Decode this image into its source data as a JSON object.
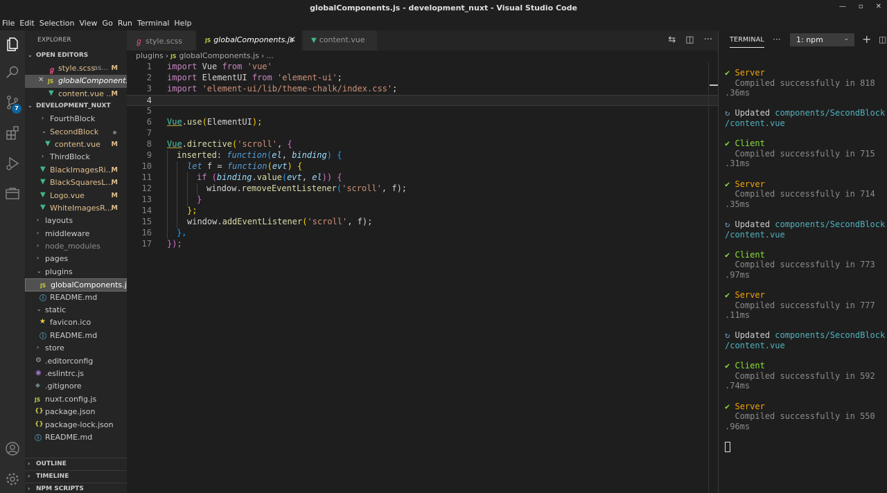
{
  "window": {
    "title": "globalComponents.js - development_nuxt - Visual Studio Code"
  },
  "menu": [
    "File",
    "Edit",
    "Selection",
    "View",
    "Go",
    "Run",
    "Terminal",
    "Help"
  ],
  "activity": {
    "scm_badge": "7"
  },
  "sidebar": {
    "title": "EXPLORER",
    "open_editors_header": "OPEN EDITORS",
    "open_editors": [
      {
        "name": "style.scss",
        "extra": "as...",
        "mark": "M"
      },
      {
        "name": "globalComponent...",
        "mark": ""
      },
      {
        "name": "content.vue ...",
        "mark": "M"
      }
    ],
    "project_header": "DEVELOPMENT_NUXT",
    "tree": [
      {
        "name": "FourthBlock",
        "mark": ""
      },
      {
        "name": "SecondBlock",
        "mark": ""
      },
      {
        "name": "content.vue",
        "mark": "M"
      },
      {
        "name": "ThirdBlock",
        "mark": ""
      },
      {
        "name": "BlackImagesRi...",
        "mark": "M"
      },
      {
        "name": "BlackSquaresL...",
        "mark": "M"
      },
      {
        "name": "Logo.vue",
        "mark": "M"
      },
      {
        "name": "WhiteImagesR...",
        "mark": "M"
      },
      {
        "name": "layouts",
        "mark": ""
      },
      {
        "name": "middleware",
        "mark": ""
      },
      {
        "name": "node_modules",
        "mark": ""
      },
      {
        "name": "pages",
        "mark": ""
      },
      {
        "name": "plugins",
        "mark": ""
      },
      {
        "name": "globalComponents.js",
        "mark": ""
      },
      {
        "name": "README.md",
        "mark": ""
      },
      {
        "name": "static",
        "mark": ""
      },
      {
        "name": "favicon.ico",
        "mark": ""
      },
      {
        "name": "README.md",
        "mark": ""
      },
      {
        "name": "store",
        "mark": ""
      },
      {
        "name": ".editorconfig",
        "mark": ""
      },
      {
        "name": ".eslintrc.js",
        "mark": ""
      },
      {
        "name": ".gitignore",
        "mark": ""
      },
      {
        "name": "nuxt.config.js",
        "mark": ""
      },
      {
        "name": "package.json",
        "mark": ""
      },
      {
        "name": "package-lock.json",
        "mark": ""
      },
      {
        "name": "README.md",
        "mark": ""
      }
    ],
    "bottom_sections": [
      "OUTLINE",
      "TIMELINE",
      "NPM SCRIPTS"
    ]
  },
  "tabs": [
    {
      "label": "style.scss",
      "icon": "scss-icon"
    },
    {
      "label": "globalComponents.js",
      "icon": "js-icon"
    },
    {
      "label": "content.vue",
      "icon": "vue-icon"
    }
  ],
  "breadcrumb": {
    "folder": "plugins",
    "file": "globalComponents.js",
    "more": "..."
  },
  "code": {
    "line_numbers": [
      "1",
      "2",
      "3",
      "4",
      "5",
      "6",
      "7",
      "8",
      "9",
      "10",
      "11",
      "12",
      "13",
      "14",
      "15",
      "16",
      "17"
    ],
    "lines": {
      "l1": [
        "import",
        " Vue ",
        "from",
        " 'vue'"
      ],
      "l2": [
        "import",
        " ElementUI ",
        "from",
        " 'element-ui'",
        ";"
      ],
      "l3": [
        "import",
        " 'element-ui/lib/theme-chalk/index.css'",
        ";"
      ],
      "l6": [
        "Vue",
        ".",
        "use",
        "(",
        "ElementUI",
        ");"
      ],
      "l8": [
        "Vue",
        ".",
        "directive",
        "(",
        "'scroll'",
        ", ",
        "{"
      ],
      "l9": [
        "inserted",
        ": ",
        "function",
        "(",
        "el",
        ", ",
        "binding",
        ") ",
        "{"
      ],
      "l10": [
        "let",
        " f = ",
        "function",
        "(",
        "evt",
        ") ",
        "{"
      ],
      "l11": [
        "if",
        " (",
        "binding",
        ".",
        "value",
        "(",
        "evt",
        ", ",
        "el",
        ")) ",
        "{"
      ],
      "l12": [
        "window",
        ".",
        "removeEventListener",
        "(",
        "'scroll'",
        ", f);"
      ],
      "l13": [
        "}"
      ],
      "l14": [
        "};"
      ],
      "l15": [
        "window",
        ".",
        "addEventListener",
        "(",
        "'scroll'",
        ", f);"
      ],
      "l16": [
        "},"
      ],
      "l17": [
        "});"
      ]
    }
  },
  "terminal": {
    "title": "TERMINAL",
    "shell": "1: npm",
    "check": "✔",
    "updated_icon": "↻",
    "server": "Server",
    "client": "Client",
    "updated": "Updated",
    "compiled": "Compiled successfully in",
    "times": [
      [
        "818",
        ".36ms"
      ],
      [
        "715",
        ".31ms"
      ],
      [
        "714",
        ".35ms"
      ],
      [
        "773",
        ".97ms"
      ],
      [
        "777",
        ".11ms"
      ],
      [
        "592",
        ".74ms"
      ],
      [
        "550",
        ".96ms"
      ]
    ],
    "updated_path_1": "components/SecondBlock",
    "updated_path_2": "/content.vue"
  }
}
